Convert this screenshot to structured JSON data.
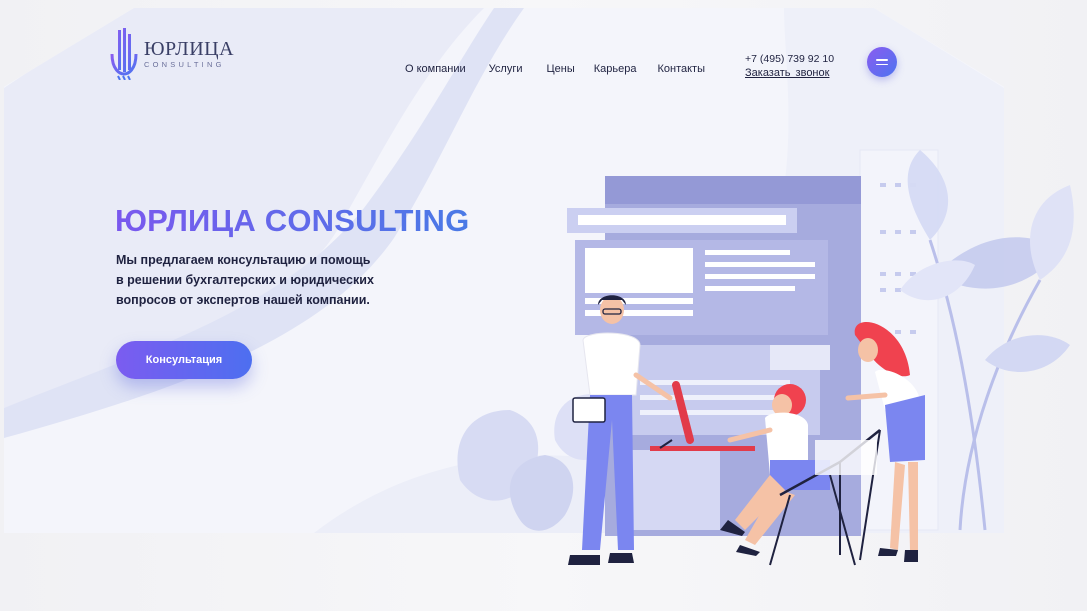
{
  "brand": {
    "name": "ЮРЛИЦА",
    "subtitle": "CONSULTING",
    "logo_icon": "columns-logo-icon"
  },
  "nav": {
    "items": [
      {
        "label": "О компании"
      },
      {
        "label": "Услуги"
      },
      {
        "label": "Цены"
      },
      {
        "label": "Карьера"
      },
      {
        "label": "Контакты"
      }
    ]
  },
  "contact": {
    "phone": "+7 (495) 739 92 10",
    "callback_label": "Заказать  звонок"
  },
  "menu": {
    "icon": "hamburger-menu-icon"
  },
  "hero": {
    "title": "ЮРЛИЦА CONSULTING",
    "text_lines": [
      "Мы предлагаем консультацию и  помощь",
      "в решении бухгалтерских и юридических",
      "вопросов от экспертов нашей компании."
    ],
    "cta_label": "Консультация"
  },
  "colors": {
    "accent_start": "#7b5cf0",
    "accent_end": "#4d6ff0",
    "background": "#f4f5fb",
    "illustration_main": "#a3a8e0",
    "figure_blue": "#7b86f0",
    "hair_red": "#f0424f"
  }
}
